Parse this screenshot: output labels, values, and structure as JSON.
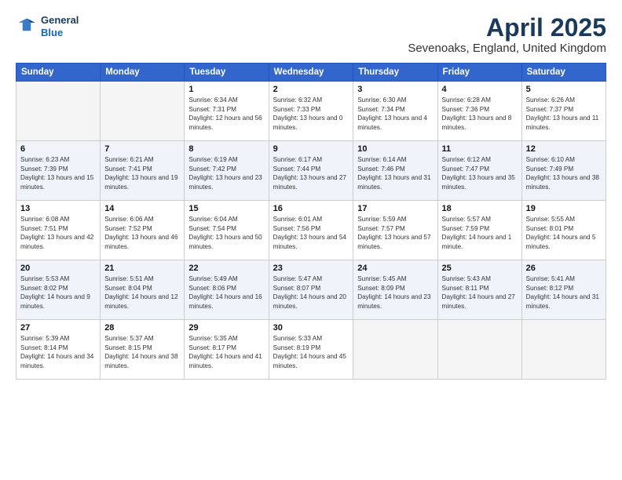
{
  "logo": {
    "line1": "General",
    "line2": "Blue"
  },
  "title": "April 2025",
  "subtitle": "Sevenoaks, England, United Kingdom",
  "weekdays": [
    "Sunday",
    "Monday",
    "Tuesday",
    "Wednesday",
    "Thursday",
    "Friday",
    "Saturday"
  ],
  "weeks": [
    [
      {
        "day": "",
        "empty": true
      },
      {
        "day": "",
        "empty": true
      },
      {
        "day": "1",
        "sunrise": "6:34 AM",
        "sunset": "7:31 PM",
        "daylight": "12 hours and 56 minutes."
      },
      {
        "day": "2",
        "sunrise": "6:32 AM",
        "sunset": "7:33 PM",
        "daylight": "13 hours and 0 minutes."
      },
      {
        "day": "3",
        "sunrise": "6:30 AM",
        "sunset": "7:34 PM",
        "daylight": "13 hours and 4 minutes."
      },
      {
        "day": "4",
        "sunrise": "6:28 AM",
        "sunset": "7:36 PM",
        "daylight": "13 hours and 8 minutes."
      },
      {
        "day": "5",
        "sunrise": "6:26 AM",
        "sunset": "7:37 PM",
        "daylight": "13 hours and 11 minutes."
      }
    ],
    [
      {
        "day": "6",
        "sunrise": "6:23 AM",
        "sunset": "7:39 PM",
        "daylight": "13 hours and 15 minutes."
      },
      {
        "day": "7",
        "sunrise": "6:21 AM",
        "sunset": "7:41 PM",
        "daylight": "13 hours and 19 minutes."
      },
      {
        "day": "8",
        "sunrise": "6:19 AM",
        "sunset": "7:42 PM",
        "daylight": "13 hours and 23 minutes."
      },
      {
        "day": "9",
        "sunrise": "6:17 AM",
        "sunset": "7:44 PM",
        "daylight": "13 hours and 27 minutes."
      },
      {
        "day": "10",
        "sunrise": "6:14 AM",
        "sunset": "7:46 PM",
        "daylight": "13 hours and 31 minutes."
      },
      {
        "day": "11",
        "sunrise": "6:12 AM",
        "sunset": "7:47 PM",
        "daylight": "13 hours and 35 minutes."
      },
      {
        "day": "12",
        "sunrise": "6:10 AM",
        "sunset": "7:49 PM",
        "daylight": "13 hours and 38 minutes."
      }
    ],
    [
      {
        "day": "13",
        "sunrise": "6:08 AM",
        "sunset": "7:51 PM",
        "daylight": "13 hours and 42 minutes."
      },
      {
        "day": "14",
        "sunrise": "6:06 AM",
        "sunset": "7:52 PM",
        "daylight": "13 hours and 46 minutes."
      },
      {
        "day": "15",
        "sunrise": "6:04 AM",
        "sunset": "7:54 PM",
        "daylight": "13 hours and 50 minutes."
      },
      {
        "day": "16",
        "sunrise": "6:01 AM",
        "sunset": "7:56 PM",
        "daylight": "13 hours and 54 minutes."
      },
      {
        "day": "17",
        "sunrise": "5:59 AM",
        "sunset": "7:57 PM",
        "daylight": "13 hours and 57 minutes."
      },
      {
        "day": "18",
        "sunrise": "5:57 AM",
        "sunset": "7:59 PM",
        "daylight": "14 hours and 1 minute."
      },
      {
        "day": "19",
        "sunrise": "5:55 AM",
        "sunset": "8:01 PM",
        "daylight": "14 hours and 5 minutes."
      }
    ],
    [
      {
        "day": "20",
        "sunrise": "5:53 AM",
        "sunset": "8:02 PM",
        "daylight": "14 hours and 9 minutes."
      },
      {
        "day": "21",
        "sunrise": "5:51 AM",
        "sunset": "8:04 PM",
        "daylight": "14 hours and 12 minutes."
      },
      {
        "day": "22",
        "sunrise": "5:49 AM",
        "sunset": "8:06 PM",
        "daylight": "14 hours and 16 minutes."
      },
      {
        "day": "23",
        "sunrise": "5:47 AM",
        "sunset": "8:07 PM",
        "daylight": "14 hours and 20 minutes."
      },
      {
        "day": "24",
        "sunrise": "5:45 AM",
        "sunset": "8:09 PM",
        "daylight": "14 hours and 23 minutes."
      },
      {
        "day": "25",
        "sunrise": "5:43 AM",
        "sunset": "8:11 PM",
        "daylight": "14 hours and 27 minutes."
      },
      {
        "day": "26",
        "sunrise": "5:41 AM",
        "sunset": "8:12 PM",
        "daylight": "14 hours and 31 minutes."
      }
    ],
    [
      {
        "day": "27",
        "sunrise": "5:39 AM",
        "sunset": "8:14 PM",
        "daylight": "14 hours and 34 minutes."
      },
      {
        "day": "28",
        "sunrise": "5:37 AM",
        "sunset": "8:15 PM",
        "daylight": "14 hours and 38 minutes."
      },
      {
        "day": "29",
        "sunrise": "5:35 AM",
        "sunset": "8:17 PM",
        "daylight": "14 hours and 41 minutes."
      },
      {
        "day": "30",
        "sunrise": "5:33 AM",
        "sunset": "8:19 PM",
        "daylight": "14 hours and 45 minutes."
      },
      {
        "day": "",
        "empty": true
      },
      {
        "day": "",
        "empty": true
      },
      {
        "day": "",
        "empty": true
      }
    ]
  ]
}
